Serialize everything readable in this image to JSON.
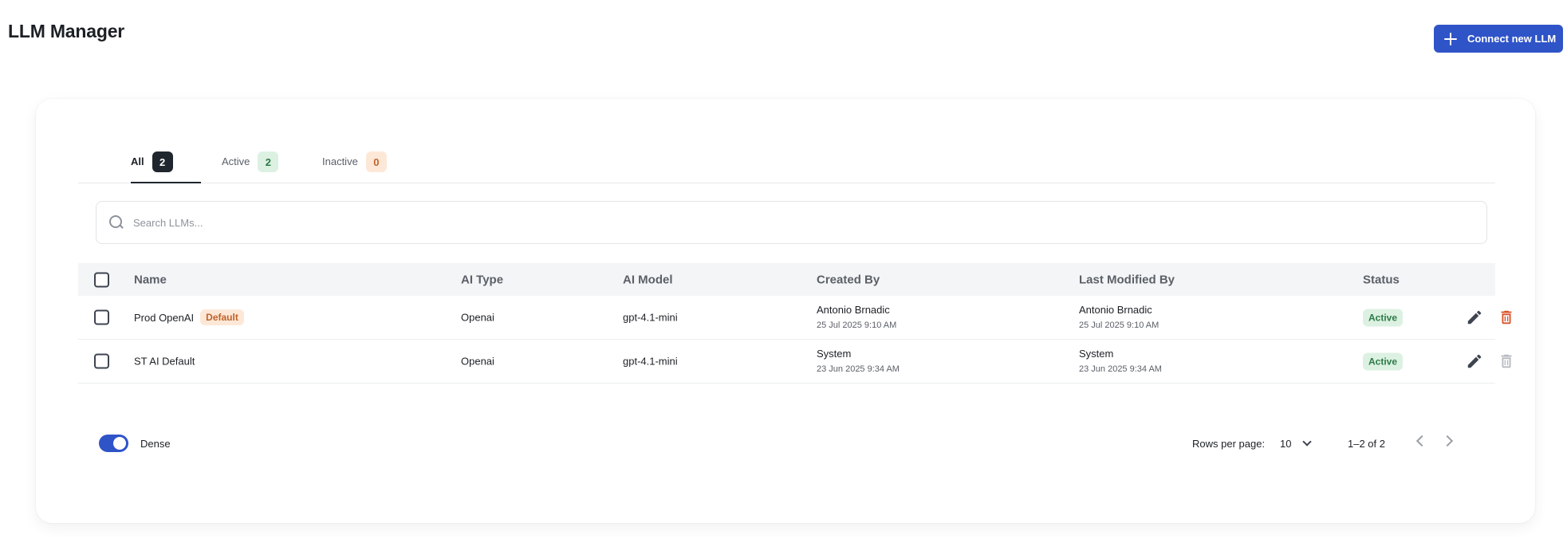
{
  "header": {
    "title": "LLM Manager",
    "connect_button": "Connect new LLM"
  },
  "tabs": [
    {
      "label": "All",
      "count": "2"
    },
    {
      "label": "Active",
      "count": "2"
    },
    {
      "label": "Inactive",
      "count": "0"
    }
  ],
  "search": {
    "placeholder": "Search LLMs...",
    "value": ""
  },
  "table": {
    "columns": [
      "Name",
      "AI Type",
      "AI Model",
      "Created By",
      "Last Modified By",
      "Status"
    ],
    "rows": [
      {
        "name": "Prod OpenAI",
        "badge": "Default",
        "ai_type": "Openai",
        "ai_model": "gpt-4.1-mini",
        "created_by": "Antonio Brnadic",
        "created_at": "25 Jul 2025 9:10 AM",
        "modified_by": "Antonio Brnadic",
        "modified_at": "25 Jul 2025 9:10 AM",
        "status": "Active",
        "delete_enabled": true
      },
      {
        "name": "ST AI Default",
        "badge": "",
        "ai_type": "Openai",
        "ai_model": "gpt-4.1-mini",
        "created_by": "System",
        "created_at": "23 Jun 2025 9:34 AM",
        "modified_by": "System",
        "modified_at": "23 Jun 2025 9:34 AM",
        "status": "Active",
        "delete_enabled": false
      }
    ]
  },
  "footer": {
    "dense_label": "Dense",
    "dense_on": true,
    "rows_per_page_label": "Rows per page:",
    "rows_per_page": "10",
    "range": "1–2 of 2"
  },
  "colors": {
    "primary": "#2f54c8",
    "delete_active": "#d9532a",
    "delete_disabled": "#b5b9bf",
    "edit": "#3e4450",
    "status_bg": "#dcf1e2",
    "status_text": "#2b7a47"
  },
  "icons": {
    "connect": "plus-icon",
    "search": "search-icon",
    "edit": "pencil-icon",
    "delete": "trash-icon",
    "rows_dropdown": "chevron-down-icon",
    "prev": "chevron-left-icon",
    "next": "chevron-right-icon"
  }
}
